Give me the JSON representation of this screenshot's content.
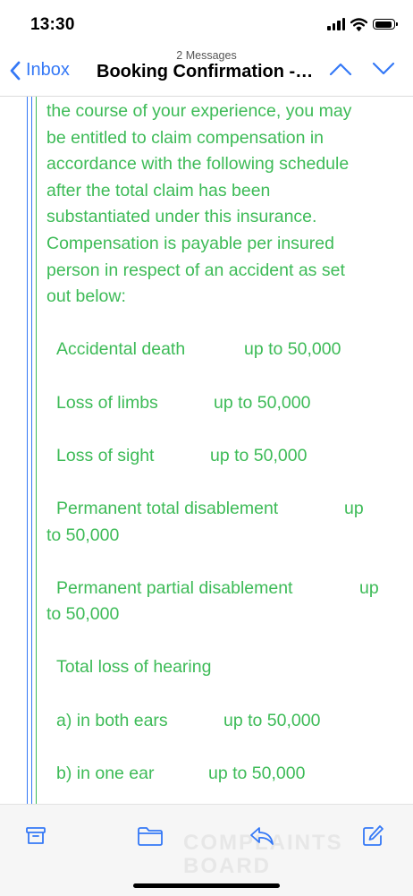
{
  "status_bar": {
    "time": "13:30"
  },
  "nav": {
    "message_count": "2 Messages",
    "back_label": "Inbox",
    "subject": "Booking Confirmation - Insurance Details"
  },
  "body": {
    "intro_lines": [
      "the course of your experience, you may",
      "be entitled to claim compensation in",
      "accordance with the following schedule",
      "after the total claim has been",
      "substantiated under this insurance.",
      "Compensation is payable per insured",
      "person in respect of an accident as set",
      "out below:"
    ],
    "schedule": [
      {
        "item": "Accidental death",
        "amount": "up to 50,000"
      },
      {
        "item": "Loss of limbs",
        "amount": "up to 50,000"
      },
      {
        "item": "Loss of sight",
        "amount": "up to 50,000"
      },
      {
        "item": "Permanent total disablement",
        "amount_start": "up",
        "amount_end": "to 50,000"
      },
      {
        "item": "Permanent partial disablement",
        "amount_start": "up",
        "amount_end": "to 50,000"
      }
    ],
    "hearing_heading": "Total loss of hearing",
    "hearing": [
      {
        "item": "a) in both ears",
        "amount": "up to 50,000"
      },
      {
        "item": "b) in one ear",
        "amount": "up to 50,000"
      }
    ]
  },
  "toolbar": {
    "icons": [
      "archive-icon",
      "folder-icon",
      "reply-icon",
      "compose-icon"
    ],
    "watermark": "COMPLAINTS BOARD"
  },
  "colors": {
    "accent": "#3478f6",
    "quote_text": "#3dbb57",
    "quote_bar_green": "#3dbb57",
    "quote_bar_blue": "#3478f6"
  }
}
